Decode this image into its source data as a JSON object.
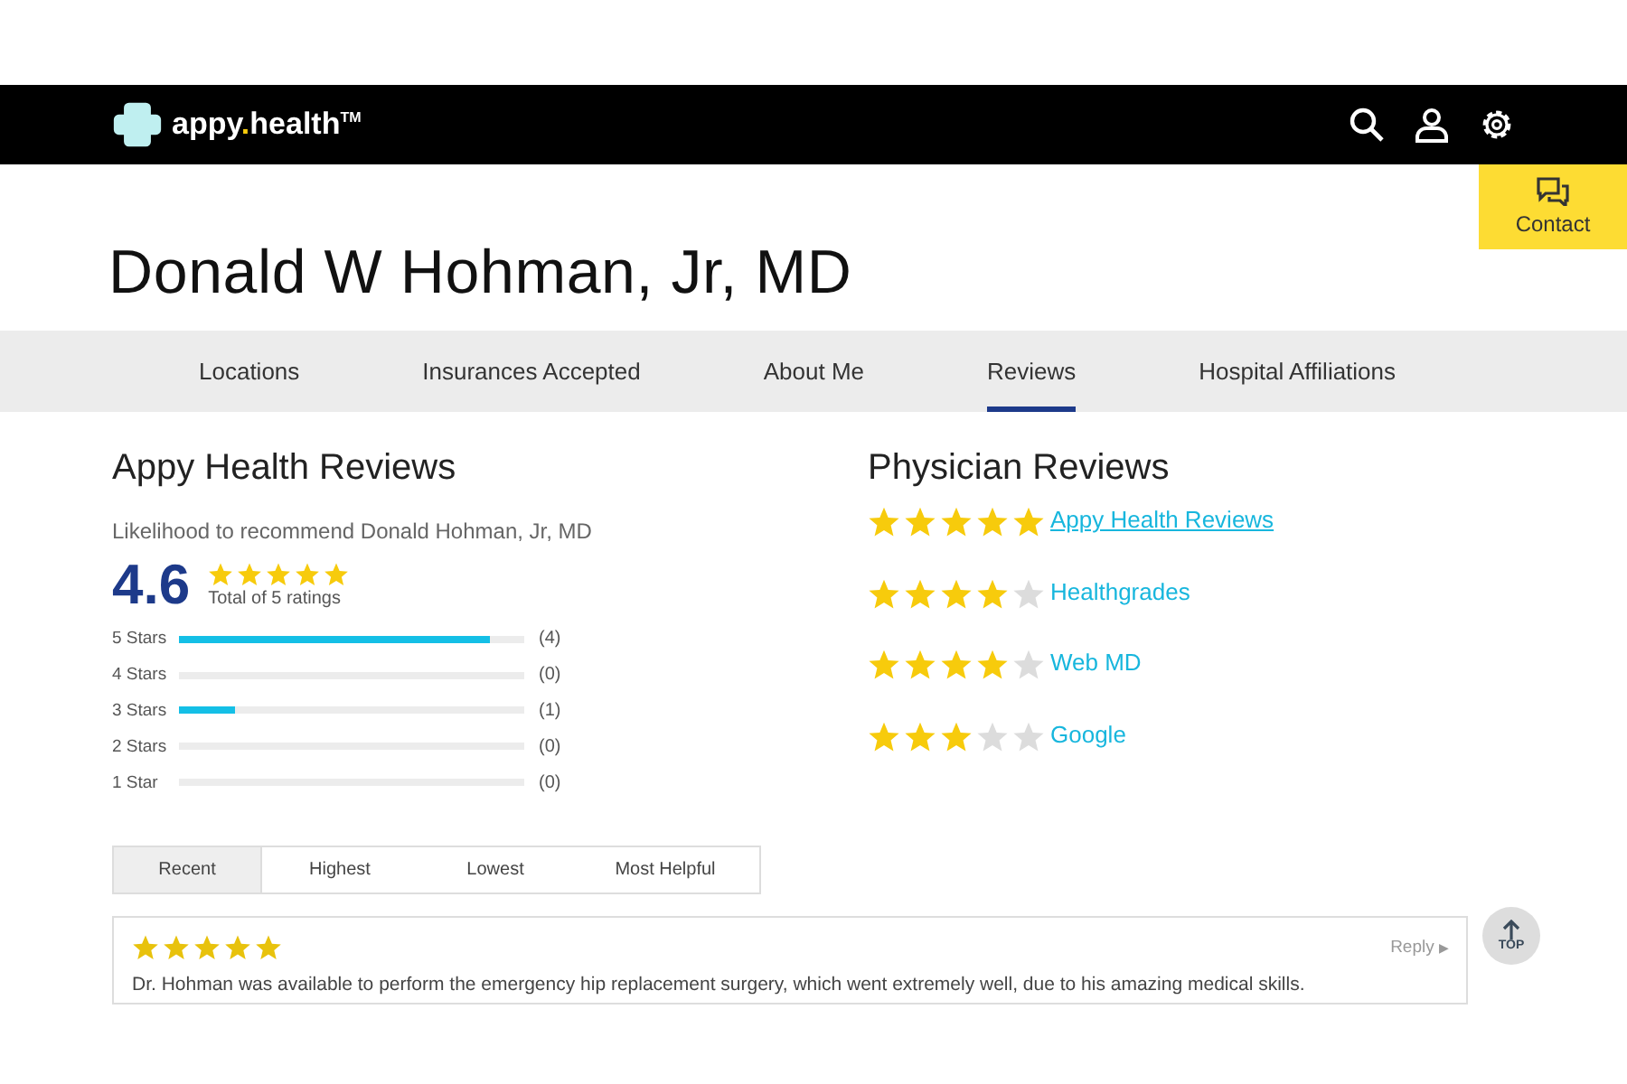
{
  "header": {
    "logo_parts": [
      "appy",
      ".",
      "health"
    ],
    "logo_mark": "TM"
  },
  "contact": {
    "label": "Contact"
  },
  "doctor": {
    "name": "Donald W Hohman, Jr, MD"
  },
  "tabs": [
    {
      "label": "Locations",
      "selected": false
    },
    {
      "label": "Insurances Accepted",
      "selected": false
    },
    {
      "label": "About Me",
      "selected": false
    },
    {
      "label": "Reviews",
      "selected": true
    },
    {
      "label": "Hospital Affiliations",
      "selected": false
    }
  ],
  "appy_reviews": {
    "title": "Appy Health Reviews",
    "subtitle": "Likelihood to recommend Donald Hohman, Jr, MD",
    "score": "4.6",
    "stars": 5,
    "total": "Total of 5 ratings",
    "breakdown": [
      {
        "label": "5 Stars",
        "level": 0.9,
        "count": "(4)"
      },
      {
        "label": "4 Stars",
        "level": 0,
        "count": "(0)"
      },
      {
        "label": "3 Stars",
        "level": 0.16,
        "count": "(1)"
      },
      {
        "label": "2 Stars",
        "level": 0,
        "count": "(0)"
      },
      {
        "label": "1 Star",
        "level": 0,
        "count": "(0)"
      }
    ]
  },
  "physician_reviews": {
    "title": "Physician Reviews",
    "sources": [
      {
        "name": "Appy Health Reviews",
        "stars": 5,
        "underlined": true
      },
      {
        "name": "Healthgrades",
        "stars": 4,
        "underlined": false
      },
      {
        "name": "Web MD",
        "stars": 4,
        "underlined": false
      },
      {
        "name": "Google",
        "stars": 3,
        "underlined": false
      }
    ]
  },
  "sort_tabs": [
    {
      "label": "Recent",
      "selected": true
    },
    {
      "label": "Highest",
      "selected": false
    },
    {
      "label": "Lowest",
      "selected": false
    },
    {
      "label": "Most Helpful",
      "selected": false
    }
  ],
  "reviews": [
    {
      "stars": 5,
      "reply": "Reply",
      "reply_arrow": "▶",
      "text": "Dr. Hohman was available to perform the emergency hip replacement surgery, which went extremely well, due to his amazing medical skills."
    }
  ],
  "top_button": {
    "label": "TOP"
  }
}
